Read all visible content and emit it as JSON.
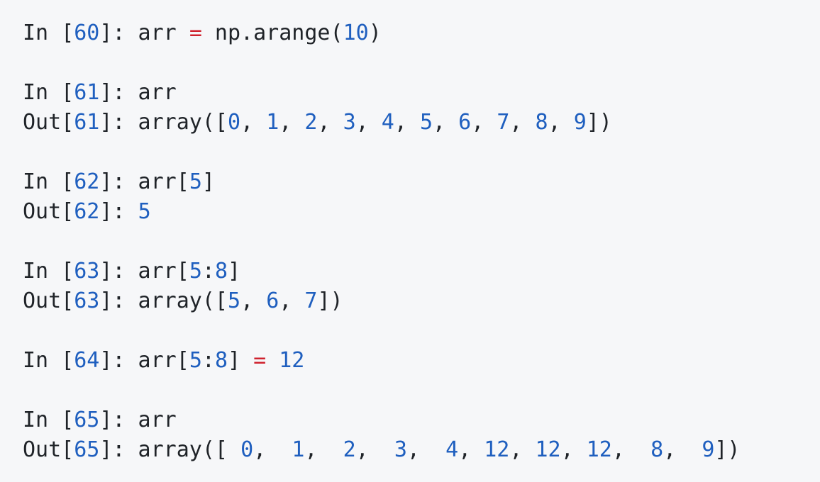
{
  "colors": {
    "background": "#f6f7f9",
    "text": "#1f2328",
    "number": "#1f5fbf",
    "operator": "#cf222e"
  },
  "lines": [
    {
      "kind": "line",
      "tokens": [
        {
          "t": "In [",
          "c": "txt"
        },
        {
          "t": "60",
          "c": "num"
        },
        {
          "t": "]: arr ",
          "c": "txt"
        },
        {
          "t": "=",
          "c": "op"
        },
        {
          "t": " np.arange(",
          "c": "txt"
        },
        {
          "t": "10",
          "c": "num"
        },
        {
          "t": ")",
          "c": "txt"
        }
      ]
    },
    {
      "kind": "blank"
    },
    {
      "kind": "line",
      "tokens": [
        {
          "t": "In [",
          "c": "txt"
        },
        {
          "t": "61",
          "c": "num"
        },
        {
          "t": "]: arr",
          "c": "txt"
        }
      ]
    },
    {
      "kind": "line",
      "tokens": [
        {
          "t": "Out[",
          "c": "txt"
        },
        {
          "t": "61",
          "c": "num"
        },
        {
          "t": "]: array([",
          "c": "txt"
        },
        {
          "t": "0",
          "c": "num"
        },
        {
          "t": ", ",
          "c": "txt"
        },
        {
          "t": "1",
          "c": "num"
        },
        {
          "t": ", ",
          "c": "txt"
        },
        {
          "t": "2",
          "c": "num"
        },
        {
          "t": ", ",
          "c": "txt"
        },
        {
          "t": "3",
          "c": "num"
        },
        {
          "t": ", ",
          "c": "txt"
        },
        {
          "t": "4",
          "c": "num"
        },
        {
          "t": ", ",
          "c": "txt"
        },
        {
          "t": "5",
          "c": "num"
        },
        {
          "t": ", ",
          "c": "txt"
        },
        {
          "t": "6",
          "c": "num"
        },
        {
          "t": ", ",
          "c": "txt"
        },
        {
          "t": "7",
          "c": "num"
        },
        {
          "t": ", ",
          "c": "txt"
        },
        {
          "t": "8",
          "c": "num"
        },
        {
          "t": ", ",
          "c": "txt"
        },
        {
          "t": "9",
          "c": "num"
        },
        {
          "t": "])",
          "c": "txt"
        }
      ]
    },
    {
      "kind": "blank"
    },
    {
      "kind": "line",
      "tokens": [
        {
          "t": "In [",
          "c": "txt"
        },
        {
          "t": "62",
          "c": "num"
        },
        {
          "t": "]: arr[",
          "c": "txt"
        },
        {
          "t": "5",
          "c": "num"
        },
        {
          "t": "]",
          "c": "txt"
        }
      ]
    },
    {
      "kind": "line",
      "tokens": [
        {
          "t": "Out[",
          "c": "txt"
        },
        {
          "t": "62",
          "c": "num"
        },
        {
          "t": "]: ",
          "c": "txt"
        },
        {
          "t": "5",
          "c": "num"
        }
      ]
    },
    {
      "kind": "blank"
    },
    {
      "kind": "line",
      "tokens": [
        {
          "t": "In [",
          "c": "txt"
        },
        {
          "t": "63",
          "c": "num"
        },
        {
          "t": "]: arr[",
          "c": "txt"
        },
        {
          "t": "5",
          "c": "num"
        },
        {
          "t": ":",
          "c": "txt"
        },
        {
          "t": "8",
          "c": "num"
        },
        {
          "t": "]",
          "c": "txt"
        }
      ]
    },
    {
      "kind": "line",
      "tokens": [
        {
          "t": "Out[",
          "c": "txt"
        },
        {
          "t": "63",
          "c": "num"
        },
        {
          "t": "]: array([",
          "c": "txt"
        },
        {
          "t": "5",
          "c": "num"
        },
        {
          "t": ", ",
          "c": "txt"
        },
        {
          "t": "6",
          "c": "num"
        },
        {
          "t": ", ",
          "c": "txt"
        },
        {
          "t": "7",
          "c": "num"
        },
        {
          "t": "])",
          "c": "txt"
        }
      ]
    },
    {
      "kind": "blank"
    },
    {
      "kind": "line",
      "tokens": [
        {
          "t": "In [",
          "c": "txt"
        },
        {
          "t": "64",
          "c": "num"
        },
        {
          "t": "]: arr[",
          "c": "txt"
        },
        {
          "t": "5",
          "c": "num"
        },
        {
          "t": ":",
          "c": "txt"
        },
        {
          "t": "8",
          "c": "num"
        },
        {
          "t": "] ",
          "c": "txt"
        },
        {
          "t": "=",
          "c": "op"
        },
        {
          "t": " ",
          "c": "txt"
        },
        {
          "t": "12",
          "c": "num"
        }
      ]
    },
    {
      "kind": "blank"
    },
    {
      "kind": "line",
      "tokens": [
        {
          "t": "In [",
          "c": "txt"
        },
        {
          "t": "65",
          "c": "num"
        },
        {
          "t": "]: arr",
          "c": "txt"
        }
      ]
    },
    {
      "kind": "line",
      "tokens": [
        {
          "t": "Out[",
          "c": "txt"
        },
        {
          "t": "65",
          "c": "num"
        },
        {
          "t": "]: array([ ",
          "c": "txt"
        },
        {
          "t": "0",
          "c": "num"
        },
        {
          "t": ",  ",
          "c": "txt"
        },
        {
          "t": "1",
          "c": "num"
        },
        {
          "t": ",  ",
          "c": "txt"
        },
        {
          "t": "2",
          "c": "num"
        },
        {
          "t": ",  ",
          "c": "txt"
        },
        {
          "t": "3",
          "c": "num"
        },
        {
          "t": ",  ",
          "c": "txt"
        },
        {
          "t": "4",
          "c": "num"
        },
        {
          "t": ", ",
          "c": "txt"
        },
        {
          "t": "12",
          "c": "num"
        },
        {
          "t": ", ",
          "c": "txt"
        },
        {
          "t": "12",
          "c": "num"
        },
        {
          "t": ", ",
          "c": "txt"
        },
        {
          "t": "12",
          "c": "num"
        },
        {
          "t": ",  ",
          "c": "txt"
        },
        {
          "t": "8",
          "c": "num"
        },
        {
          "t": ",  ",
          "c": "txt"
        },
        {
          "t": "9",
          "c": "num"
        },
        {
          "t": "])",
          "c": "txt"
        }
      ]
    }
  ]
}
